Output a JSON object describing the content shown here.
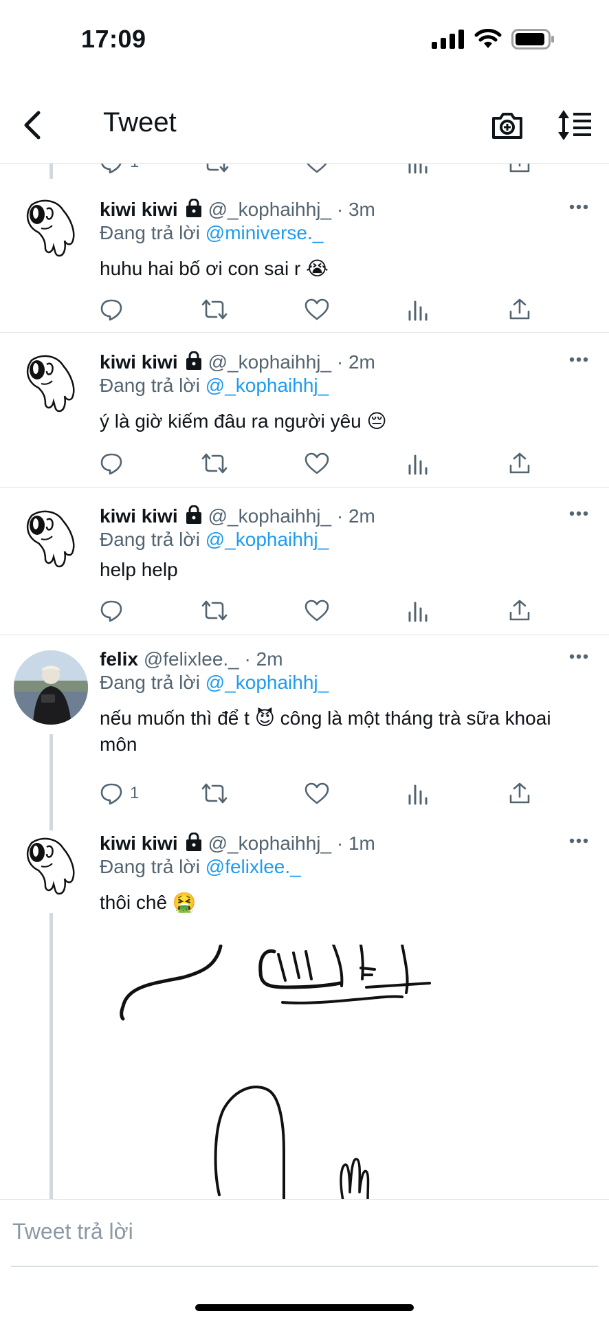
{
  "status_bar": {
    "time": "17:09"
  },
  "header": {
    "title": "Tweet"
  },
  "tweets": [
    {
      "name": "kiwi kiwi",
      "handle": "@_kophaihhj_",
      "time": "· 3m",
      "reply_prefix": "Đang trả lời",
      "reply_to": "@miniverse._",
      "text": "huhu hai bố ơi con sai r 😭"
    },
    {
      "name": "kiwi kiwi",
      "handle": "@_kophaihhj_",
      "time": "· 2m",
      "reply_prefix": "Đang trả lời",
      "reply_to": "@_kophaihhj_",
      "text": "ý là giờ kiếm đâu ra người yêu 😔"
    },
    {
      "name": "kiwi kiwi",
      "handle": "@_kophaihhj_",
      "time": "· 2m",
      "reply_prefix": "Đang trả lời",
      "reply_to": "@_kophaihhj_",
      "text": "help help"
    },
    {
      "name": "felix",
      "handle": "@felixlee._",
      "time": "· 2m",
      "reply_prefix": "Đang trả lời",
      "reply_to": "@_kophaihhj_",
      "text": "nếu muốn thì để t 😈  công là một tháng trà sữa khoai môn",
      "reply_count": "1"
    },
    {
      "name": "kiwi kiwi",
      "handle": "@_kophaihhj_",
      "time": "· 1m",
      "reply_prefix": "Đang trả lời",
      "reply_to": "@felixlee._",
      "text": "thôi chê 🤮"
    }
  ],
  "top_partial": {
    "reply_count": "1"
  },
  "reply_bar": {
    "placeholder": "Tweet trả lời"
  },
  "colors": {
    "link": "#1d9bf0",
    "secondary": "#536471",
    "divider": "#e1e5e8"
  }
}
